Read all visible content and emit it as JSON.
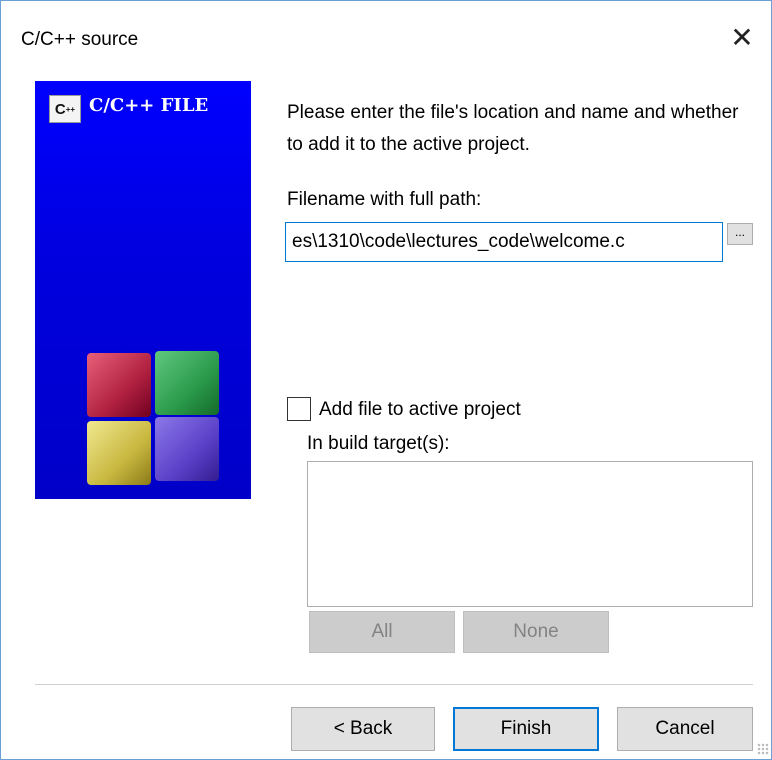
{
  "window": {
    "title": "C/C++ source",
    "close_icon": "close-icon"
  },
  "banner": {
    "logo_text": "C",
    "logo_superscript": "++",
    "title": "C/C++ FILE",
    "background": "#0000ff",
    "cubes": [
      "red",
      "green",
      "yellow",
      "purple"
    ]
  },
  "form": {
    "prompt": "Please enter the file's location and name and whether to add it to the active project.",
    "path_label": "Filename with full path:",
    "path_value": "es\\1310\\code\\lectures_code\\welcome.c",
    "browse_label": "...",
    "add_to_project": {
      "label": "Add file to active project",
      "checked": false
    },
    "targets_label": "In build target(s):",
    "targets": [],
    "all_label": "All",
    "none_label": "None"
  },
  "footer": {
    "back_label": "< Back",
    "finish_label": "Finish",
    "cancel_label": "Cancel"
  },
  "colors": {
    "accent": "#0078d7",
    "banner_blue": "#0000ff"
  }
}
